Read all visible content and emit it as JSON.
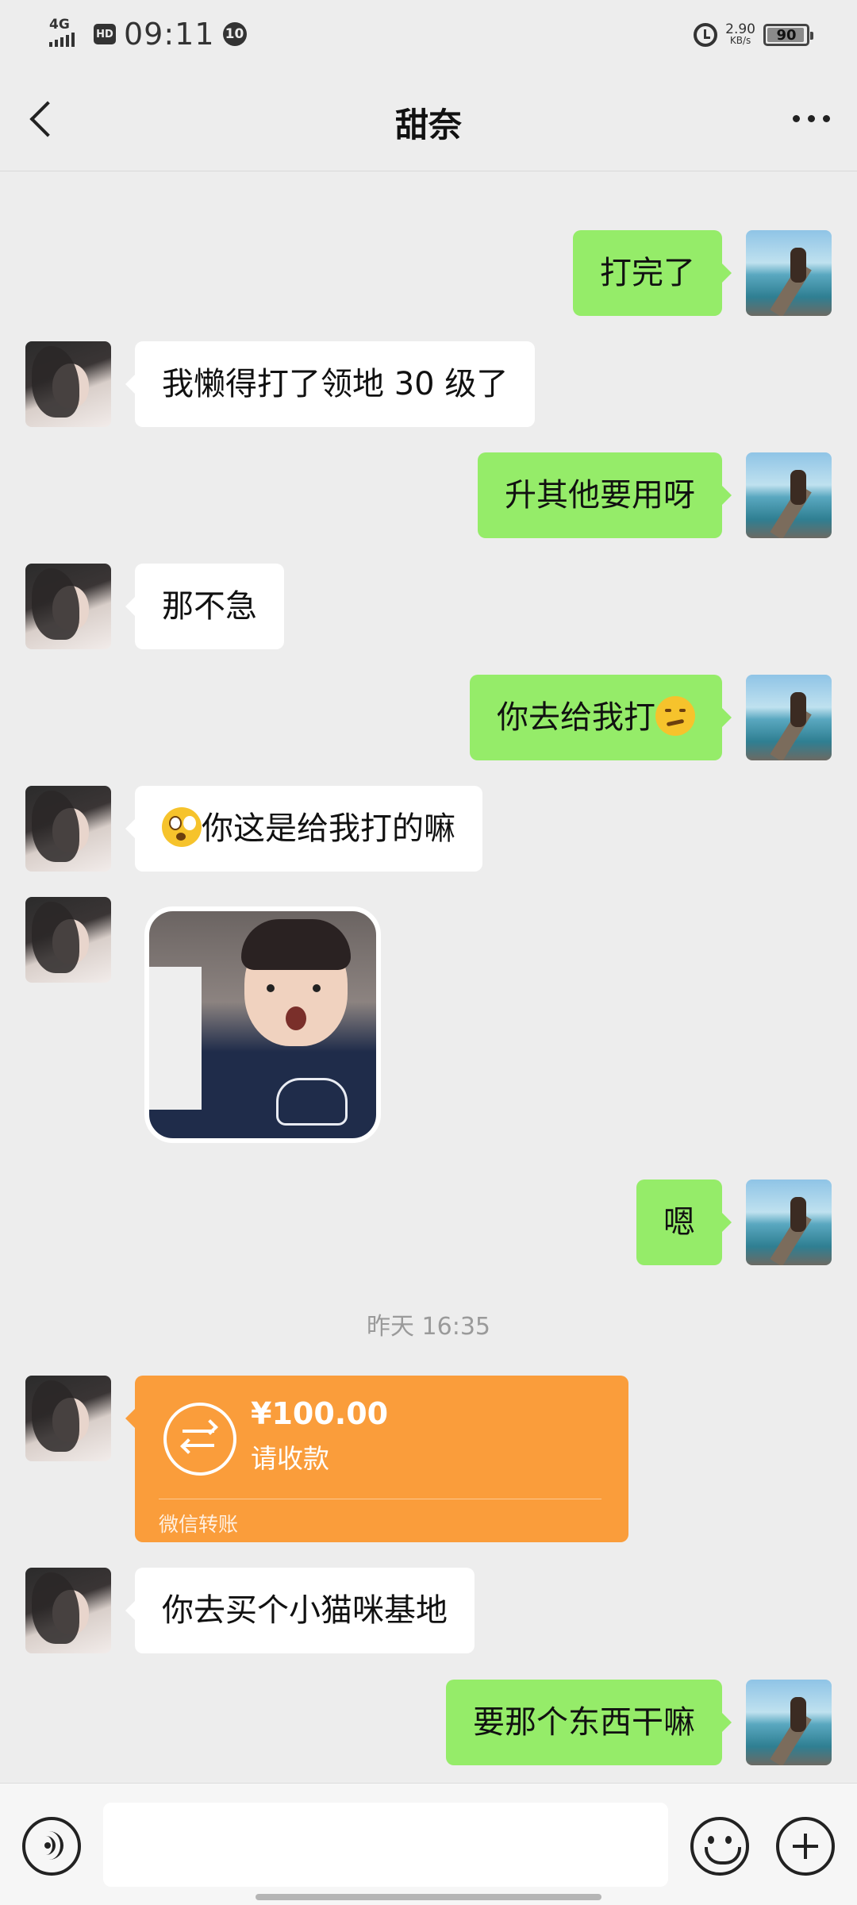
{
  "status_bar": {
    "network": "4G",
    "hd": "HD",
    "time": "09:11",
    "notification_count": "10",
    "speed_value": "2.90",
    "speed_unit": "KB/s",
    "battery": "90"
  },
  "header": {
    "title": "甜奈"
  },
  "messages": [
    {
      "from": "me",
      "text": "打完了"
    },
    {
      "from": "her",
      "text": "我懒得打了领地 30 级了"
    },
    {
      "from": "me",
      "text": "升其他要用呀"
    },
    {
      "from": "her",
      "text": "那不急"
    },
    {
      "from": "me",
      "text": "你去给我打",
      "emoji": "thinking-face"
    },
    {
      "from": "her",
      "text": "你这是给我打的嘛",
      "emoji": "flushed-face"
    },
    {
      "from": "her",
      "type": "sticker",
      "sticker": "toddler-shouting"
    },
    {
      "from": "me",
      "text": "嗯"
    },
    {
      "type": "timestamp",
      "text": "昨天 16:35"
    },
    {
      "from": "her",
      "type": "transfer",
      "amount": "¥100.00",
      "status": "请收款",
      "label": "微信转账"
    },
    {
      "from": "her",
      "text": "你去买个小猫咪基地"
    },
    {
      "from": "me",
      "text": "要那个东西干嘛"
    }
  ],
  "input_bar": {
    "placeholder": "",
    "value": ""
  },
  "colors": {
    "background": "#ededed",
    "outgoing_bubble": "#95ec69",
    "incoming_bubble": "#ffffff",
    "transfer_card": "#fa9d3b"
  },
  "icons": {
    "back": "back-chevron-icon",
    "more": "more-dots-icon",
    "voice": "voice-icon",
    "emoji": "emoji-icon",
    "plus": "plus-icon",
    "transfer": "transfer-arrows-icon"
  }
}
